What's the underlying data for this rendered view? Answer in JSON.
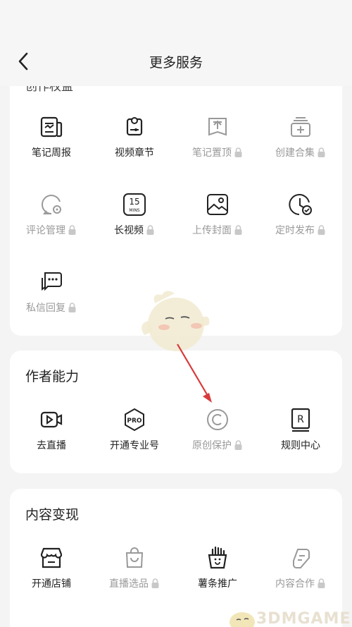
{
  "header": {
    "title": "更多服务"
  },
  "section1": {
    "cut_title": "创作权益",
    "items": [
      {
        "label": "笔记周报",
        "icon": "report-icon",
        "locked": false
      },
      {
        "label": "视频章节",
        "icon": "video-chapter-icon",
        "locked": false
      },
      {
        "label": "笔记置顶",
        "icon": "pin-top-icon",
        "locked": true
      },
      {
        "label": "创建合集",
        "icon": "collection-icon",
        "locked": true
      },
      {
        "label": "评论管理",
        "icon": "comment-manage-icon",
        "locked": true
      },
      {
        "label": "长视频",
        "icon": "long-video-icon",
        "locked": false
      },
      {
        "label": "上传封面",
        "icon": "upload-cover-icon",
        "locked": true
      },
      {
        "label": "定时发布",
        "icon": "scheduled-publish-icon",
        "locked": true
      },
      {
        "label": "私信回复",
        "icon": "dm-reply-icon",
        "locked": true
      }
    ],
    "long_video_badge_top": "15",
    "long_video_badge_bottom": "MINS"
  },
  "section2": {
    "title": "作者能力",
    "items": [
      {
        "label": "去直播",
        "icon": "live-icon",
        "locked": false
      },
      {
        "label": "开通专业号",
        "icon": "pro-icon",
        "locked": false
      },
      {
        "label": "原创保护",
        "icon": "copyright-icon",
        "locked": true
      },
      {
        "label": "规则中心",
        "icon": "rules-icon",
        "locked": false
      }
    ],
    "pro_badge": "PRO",
    "rules_badge": "R"
  },
  "section3": {
    "title": "内容变现",
    "items": [
      {
        "label": "开通店铺",
        "icon": "shop-icon",
        "locked": false
      },
      {
        "label": "直播选品",
        "icon": "shopping-bag-icon",
        "locked": true
      },
      {
        "label": "薯条推广",
        "icon": "fries-icon",
        "locked": false
      },
      {
        "label": "内容合作",
        "icon": "cooperation-icon",
        "locked": true
      }
    ]
  },
  "watermark": {
    "text": "3DMGAME"
  },
  "colors": {
    "locked_text": "#999999",
    "accent_arrow": "#d93a3a",
    "card_bg": "#ffffff",
    "page_bg": "#f4f4f4"
  }
}
